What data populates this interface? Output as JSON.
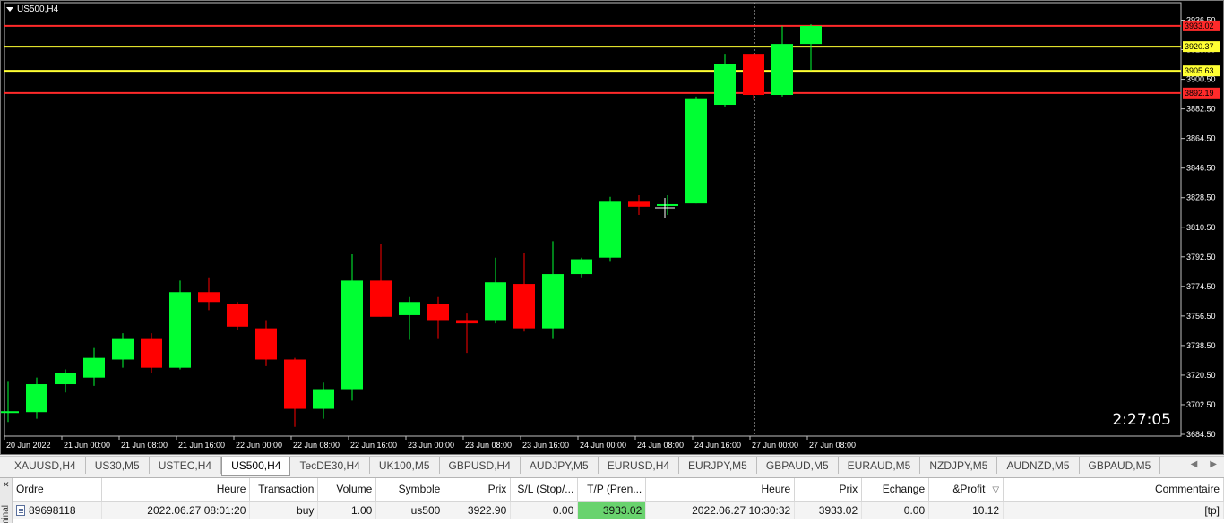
{
  "chart": {
    "symbol_title": "US500,H4",
    "countdown": "2:27:05",
    "price_axis_ticks": [
      "3936.50",
      "3918.50",
      "3900.50",
      "3882.50",
      "3864.50",
      "3846.50",
      "3828.50",
      "3810.50",
      "3792.50",
      "3774.50",
      "3756.50",
      "3738.50",
      "3720.50",
      "3702.50",
      "3684.50"
    ],
    "time_axis_ticks": [
      "20 Jun 2022",
      "21 Jun 00:00",
      "21 Jun 08:00",
      "21 Jun 16:00",
      "22 Jun 00:00",
      "22 Jun 08:00",
      "22 Jun 16:00",
      "23 Jun 00:00",
      "23 Jun 08:00",
      "23 Jun 16:00",
      "24 Jun 00:00",
      "24 Jun 08:00",
      "24 Jun 16:00",
      "27 Jun 00:00",
      "27 Jun 08:00"
    ],
    "horizontal_lines": [
      {
        "price": 3933.02,
        "label": "3933.02",
        "color": "#ff2a2a"
      },
      {
        "price": 3920.37,
        "label": "3920.37",
        "color": "#ffff33"
      },
      {
        "price": 3905.63,
        "label": "3905.63",
        "color": "#ffff33"
      },
      {
        "price": 3892.19,
        "label": "3892.19",
        "color": "#ff2a2a"
      }
    ],
    "colors": {
      "bull": "#00ff33",
      "bear": "#ff0000",
      "background": "#000000",
      "wick": "#cccccc"
    }
  },
  "chart_data": {
    "type": "candlestick",
    "title": "US500,H4",
    "ylim": [
      3684.5,
      3939.5
    ],
    "candles": [
      {
        "open": 3698,
        "high": 3717,
        "low": 3692,
        "close": 3698
      },
      {
        "open": 3698,
        "high": 3719,
        "low": 3694,
        "close": 3715
      },
      {
        "open": 3715,
        "high": 3724,
        "low": 3710,
        "close": 3722
      },
      {
        "open": 3719,
        "high": 3737,
        "low": 3714,
        "close": 3731
      },
      {
        "open": 3730,
        "high": 3746,
        "low": 3725,
        "close": 3743
      },
      {
        "open": 3743,
        "high": 3746,
        "low": 3722,
        "close": 3725
      },
      {
        "open": 3725,
        "high": 3778,
        "low": 3724,
        "close": 3771
      },
      {
        "open": 3771,
        "high": 3780,
        "low": 3760,
        "close": 3765
      },
      {
        "open": 3764,
        "high": 3765,
        "low": 3748,
        "close": 3750
      },
      {
        "open": 3749,
        "high": 3754,
        "low": 3726,
        "close": 3730
      },
      {
        "open": 3730,
        "high": 3731,
        "low": 3689,
        "close": 3700
      },
      {
        "open": 3700,
        "high": 3716,
        "low": 3694,
        "close": 3712
      },
      {
        "open": 3712,
        "high": 3794,
        "low": 3705,
        "close": 3778
      },
      {
        "open": 3778,
        "high": 3800,
        "low": 3756,
        "close": 3756
      },
      {
        "open": 3757,
        "high": 3768,
        "low": 3742,
        "close": 3765
      },
      {
        "open": 3764,
        "high": 3768,
        "low": 3743,
        "close": 3754
      },
      {
        "open": 3754,
        "high": 3758,
        "low": 3734,
        "close": 3752
      },
      {
        "open": 3754,
        "high": 3792,
        "low": 3752,
        "close": 3777
      },
      {
        "open": 3776,
        "high": 3795,
        "low": 3747,
        "close": 3749
      },
      {
        "open": 3749,
        "high": 3802,
        "low": 3743,
        "close": 3782
      },
      {
        "open": 3782,
        "high": 3792,
        "low": 3780,
        "close": 3791
      },
      {
        "open": 3792,
        "high": 3829,
        "low": 3790,
        "close": 3826
      },
      {
        "open": 3826,
        "high": 3830,
        "low": 3818,
        "close": 3823
      },
      {
        "open": 3824,
        "high": 3830,
        "low": 3818,
        "close": 3824
      },
      {
        "open": 3825,
        "high": 3890,
        "low": 3825,
        "close": 3889
      },
      {
        "open": 3885,
        "high": 3916,
        "low": 3884,
        "close": 3910
      },
      {
        "open": 3916,
        "high": 3916,
        "low": 3888,
        "close": 3891
      },
      {
        "open": 3891,
        "high": 3933,
        "low": 3890,
        "close": 3922
      },
      {
        "open": 3922,
        "high": 3934,
        "low": 3906,
        "close": 3933
      }
    ]
  },
  "tabs": {
    "items": [
      "XAUUSD,H4",
      "US30,M5",
      "USTEC,H4",
      "US500,H4",
      "TecDE30,H4",
      "UK100,M5",
      "GBPUSD,H4",
      "AUDJPY,M5",
      "EURUSD,H4",
      "EURJPY,M5",
      "GBPAUD,M5",
      "EURAUD,M5",
      "NZDJPY,M5",
      "AUDNZD,M5",
      "GBPAUD,M5"
    ],
    "active_index": 3
  },
  "terminal": {
    "side_label": "minal",
    "headers": [
      "Ordre",
      "Heure",
      "Transaction",
      "Volume",
      "Symbole",
      "Prix",
      "S/L (Stop/...",
      "T/P (Pren...",
      "Heure",
      "Prix",
      "Echange",
      "&Profit",
      "Commentaire"
    ],
    "sort_icon": "▽",
    "row": [
      "89698118",
      "2022.06.27 08:01:20",
      "buy",
      "1.00",
      "us500",
      "3922.90",
      "0.00",
      "3933.02",
      "2022.06.27 10:30:32",
      "3933.02",
      "0.00",
      "10.12",
      "[tp]"
    ]
  }
}
